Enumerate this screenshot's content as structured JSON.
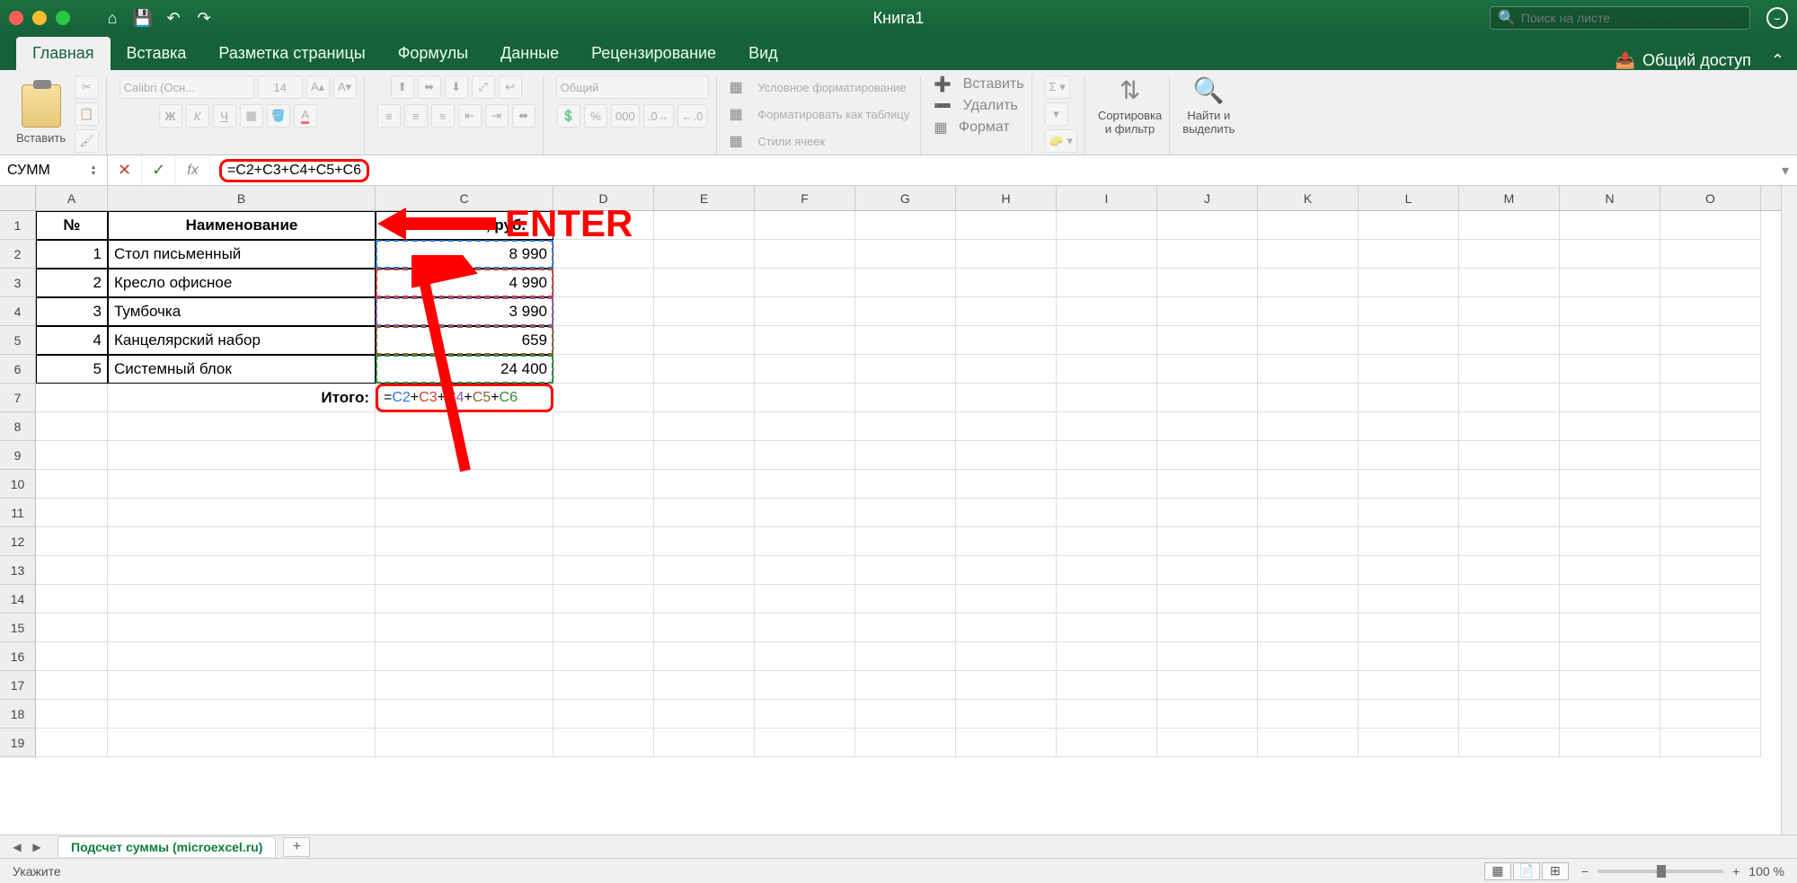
{
  "title": "Книга1",
  "search_placeholder": "Поиск на листе",
  "tabs": [
    "Главная",
    "Вставка",
    "Разметка страницы",
    "Формулы",
    "Данные",
    "Рецензирование",
    "Вид"
  ],
  "share": "Общий доступ",
  "ribbon": {
    "paste": "Вставить",
    "font_name": "Calibri (Осн...",
    "font_size": "14",
    "number_format": "Общий",
    "cond_format": "Условное форматирование",
    "format_table": "Форматировать как таблицу",
    "cell_styles": "Стили ячеек",
    "insert": "Вставить",
    "delete": "Удалить",
    "format": "Формат",
    "sort_filter": "Сортировка\nи фильтр",
    "find_select": "Найти и\nвыделить"
  },
  "namebox": "СУММ",
  "formula": "=C2+C3+C4+C5+C6",
  "enter_label": "ENTER",
  "columns": [
    "A",
    "B",
    "C",
    "D",
    "E",
    "F",
    "G",
    "H",
    "I",
    "J",
    "K",
    "L",
    "M",
    "N",
    "O"
  ],
  "headers": {
    "a": "№",
    "b": "Наименование",
    "c": "Стоимость, руб."
  },
  "data_rows": [
    {
      "n": "1",
      "name": "Стол письменный",
      "cost": "8 990"
    },
    {
      "n": "2",
      "name": "Кресло офисное",
      "cost": "4 990"
    },
    {
      "n": "3",
      "name": "Тумбочка",
      "cost": "3 990"
    },
    {
      "n": "4",
      "name": "Канцелярский набор",
      "cost": "659"
    },
    {
      "n": "5",
      "name": "Системный блок",
      "cost": "24 400"
    }
  ],
  "total_label": "Итого:",
  "editing_cell": {
    "parts": [
      "=",
      "C2",
      "+",
      "C3",
      "+",
      "C4",
      "+",
      "C5",
      "+",
      "C6"
    ]
  },
  "sheet_name": "Подсчет суммы (microexcel.ru)",
  "status_text": "Укажите",
  "zoom": "100 %"
}
